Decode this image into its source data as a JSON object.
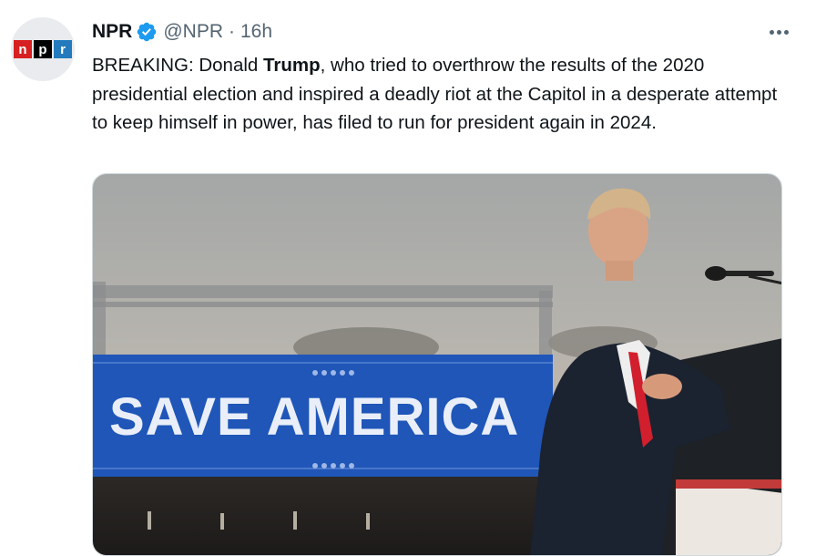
{
  "tweet": {
    "author_name": "NPR",
    "handle": "@NPR",
    "separator": "·",
    "time": "16h",
    "logo_letters": [
      "n",
      "p",
      "r"
    ],
    "text_before": "BREAKING: Donald ",
    "text_bold": "Trump",
    "text_after": ", who tried to overthrow the results of the 2020 presidential election and inspired a deadly riot at the Capitol in a desperate attempt to keep himself in power, has filed to run for president again in 2024."
  },
  "media": {
    "banner_text": "SAVE AMERICA"
  },
  "colors": {
    "npr_n": "#d62021",
    "npr_p": "#000000",
    "npr_r": "#237bbd",
    "verified": "#1d9bf0",
    "banner": "#1f56b8"
  },
  "icons": {
    "verified": "verified-badge-icon",
    "more": "more-options-icon"
  }
}
